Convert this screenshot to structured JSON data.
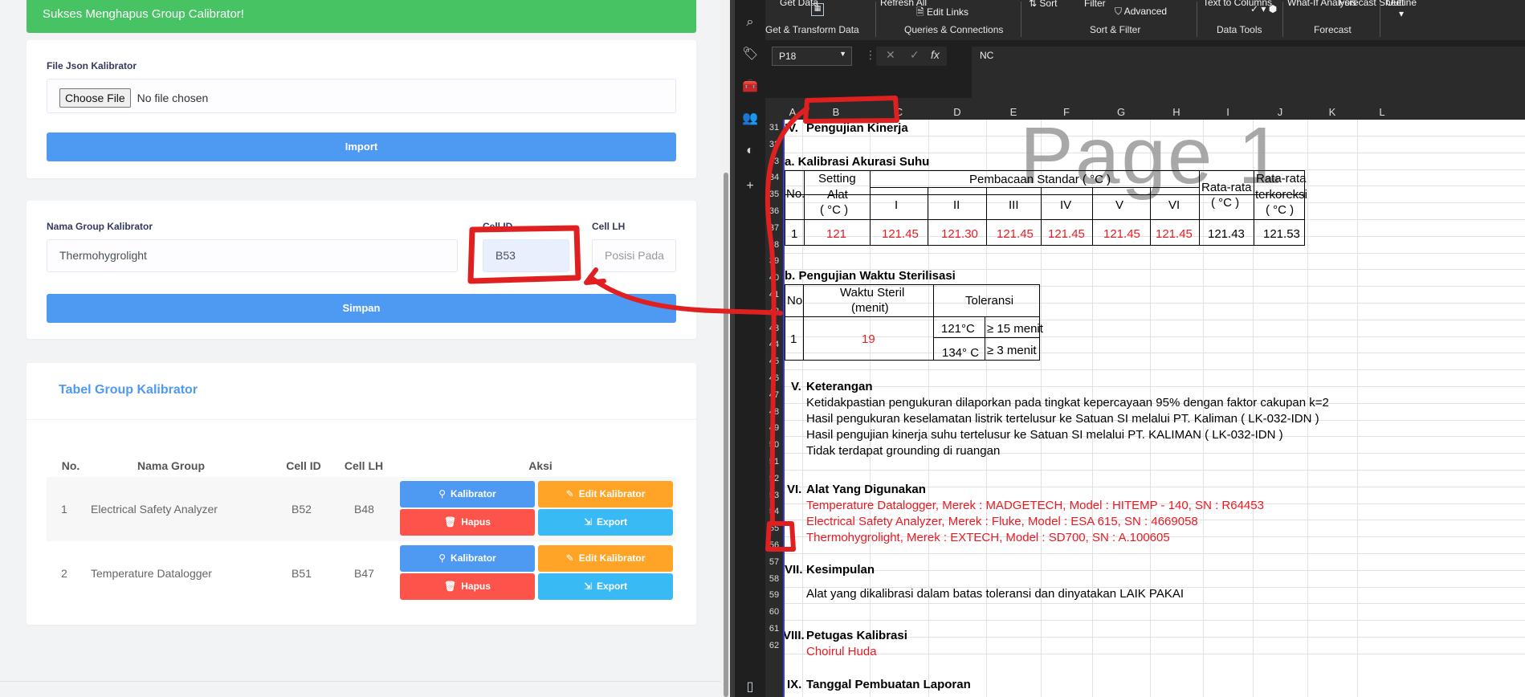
{
  "alert": {
    "message": "Sukses Menghapus Group Calibrator!"
  },
  "import_card": {
    "file_label": "File Json Kalibrator",
    "choose_button": "Choose File",
    "no_file": "No file chosen",
    "import_button": "Import"
  },
  "form_card": {
    "group_name_label": "Nama Group Kalibrator",
    "group_name_value": "Thermohygrolight",
    "cell_id_label": "Cell ID",
    "cell_id_value": "B53",
    "cell_lh_label": "Cell LH",
    "cell_lh_placeholder": "Posisi Pada",
    "save_button": "Simpan"
  },
  "table_card": {
    "title": "Tabel Group Kalibrator",
    "headers": [
      "No.",
      "Nama Group",
      "Cell ID",
      "Cell LH",
      "Aksi"
    ],
    "rows": [
      {
        "no": "1",
        "name": "Electrical Safety Analyzer",
        "cell_id": "B52",
        "cell_lh": "B48"
      },
      {
        "no": "2",
        "name": "Temperature Datalogger",
        "cell_id": "B51",
        "cell_lh": "B47"
      }
    ],
    "actions": {
      "kalibrator": "Kalibrator",
      "edit": "Edit Kalibrator",
      "hapus": "Hapus",
      "export": "Export"
    }
  },
  "excel": {
    "ribbon": {
      "get_data": "Get Data",
      "refresh_all": "Refresh All",
      "edit_links": "Edit Links",
      "sort": "Sort",
      "filter": "Filter",
      "advanced": "Advanced",
      "text_to_columns": "Text to Columns",
      "what_if": "What-If Analysis",
      "forecast_sheet": "Forecast Sheet",
      "outline": "Outline",
      "groups": [
        "Get & Transform Data",
        "Queries & Connections",
        "Sort & Filter",
        "Data Tools",
        "Forecast"
      ]
    },
    "name_box": "P18",
    "formula": "NC",
    "columns": [
      "A",
      "B",
      "C",
      "D",
      "E",
      "F",
      "G",
      "H",
      "I",
      "J",
      "K",
      "L"
    ],
    "rows": [
      "31",
      "32",
      "33",
      "34",
      "35",
      "36",
      "37",
      "38",
      "39",
      "40",
      "41",
      "42",
      "43",
      "44",
      "45",
      "46",
      "47",
      "48",
      "49",
      "50",
      "51",
      "52",
      "53",
      "54",
      "55",
      "56",
      "57",
      "58",
      "59",
      "60",
      "61",
      "62"
    ],
    "watermark": "Page 1",
    "sec4": {
      "num": "IV.",
      "title": "Pengujian Kinerja"
    },
    "sec_a": "a. Kalibrasi Akurasi Suhu",
    "table_a": {
      "no": "No.",
      "setting": "Setting",
      "alat": "Alat",
      "unit": "( °C )",
      "pembacaan": "Pembacaan  Standar ( °C )",
      "roman": [
        "I",
        "II",
        "III",
        "IV",
        "V",
        "VI"
      ],
      "rata": "Rata-rata",
      "rata_unit": "( °C )",
      "rata_k": "Rata-rata",
      "rata_k2": "terkoreksi",
      "rata_k_unit": "( °C )",
      "row": {
        "no": "1",
        "setting": "121",
        "vals": [
          "121.45",
          "121.30",
          "121.45",
          "121.45",
          "121.45",
          "121.45"
        ],
        "avg": "121.43",
        "corr": "121.53"
      }
    },
    "sec_b": "b. Pengujian Waktu Sterilisasi",
    "table_b": {
      "no": "No",
      "waktu": "Waktu Steril",
      "menit": "(menit)",
      "tol": "Toleransi",
      "row_no": "1",
      "row_val": "19",
      "t1": "121°C",
      "t1v": "≥ 15 menit",
      "t2": "134° C",
      "t2v": "≥ 3 menit"
    },
    "sec5": {
      "num": "V.",
      "title": "Keterangan"
    },
    "notes": [
      "Ketidakpastian pengukuran dilaporkan pada tingkat kepercayaan 95% dengan faktor cakupan k=2",
      "Hasil pengukuran keselamatan listrik tertelusur ke Satuan SI melalui PT. Kaliman ( LK-032-IDN )",
      "Hasil pengujian kinerja suhu tertelusur ke Satuan SI melalui PT. KALIMAN ( LK-032-IDN )",
      "Tidak terdapat grounding di ruangan"
    ],
    "sec6": {
      "num": "VI.",
      "title": "Alat Yang Digunakan"
    },
    "tools": [
      "Temperature Datalogger, Merek : MADGETECH, Model : HITEMP - 140, SN : R64453",
      "Electrical Safety Analyzer, Merek : Fluke, Model : ESA 615, SN : 4669058",
      "Thermohygrolight, Merek : EXTECH, Model : SD700, SN : A.100605"
    ],
    "sec7": {
      "num": "VII.",
      "title": "Kesimpulan"
    },
    "kesimpulan": "Alat yang dikalibrasi dalam batas toleransi dan dinyatakan LAIK PAKAI",
    "sec8": {
      "num": "VIII.",
      "title": "Petugas Kalibrasi"
    },
    "petugas": "Choirul Huda",
    "sec9": {
      "num": "IX.",
      "title": "Tanggal Pembuatan Laporan"
    }
  },
  "colors": {
    "primary": "#4e9af3",
    "success": "#47c363",
    "warning": "#ffa426",
    "danger": "#fc544b",
    "info": "#3abaf4",
    "annotation": "#e02020"
  }
}
